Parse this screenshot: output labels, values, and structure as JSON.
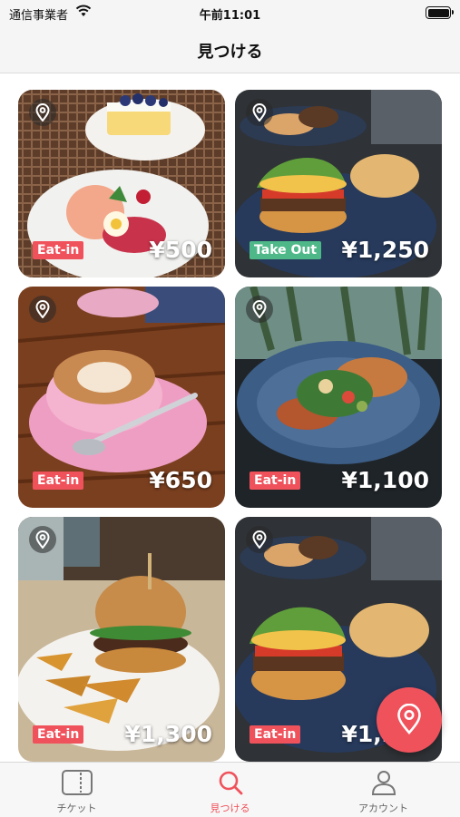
{
  "status_bar": {
    "carrier": "通信事業者",
    "time": "午前11:01"
  },
  "nav": {
    "title": "見つける"
  },
  "cards": [
    {
      "tag": "Eat-in",
      "price": "¥500"
    },
    {
      "tag": "Take Out",
      "price": "¥1,250"
    },
    {
      "tag": "Eat-in",
      "price": "¥650"
    },
    {
      "tag": "Eat-in",
      "price": "¥1,100"
    },
    {
      "tag": "Eat-in",
      "price": "¥1,300"
    },
    {
      "tag": "Eat-in",
      "price": "¥1,250"
    }
  ],
  "tabs": [
    {
      "label": "チケット",
      "icon": "ticket-icon"
    },
    {
      "label": "見つける",
      "icon": "search-icon"
    },
    {
      "label": "アカウント",
      "icon": "person-icon"
    }
  ],
  "colors": {
    "accent": "#f0525c",
    "takeout": "#4fb889"
  }
}
